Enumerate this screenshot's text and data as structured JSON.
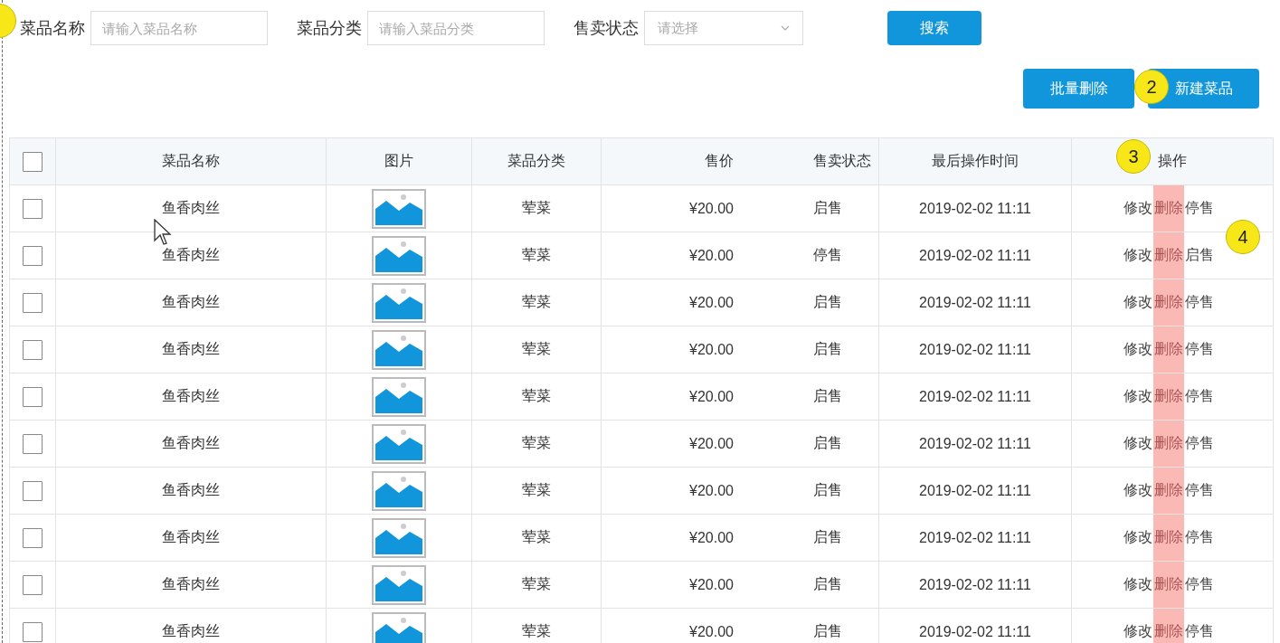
{
  "filters": [
    {
      "label": "菜品名称",
      "kind": "input",
      "placeholder": "请输入菜品名称"
    },
    {
      "label": "菜品分类",
      "kind": "input",
      "placeholder": "请输入菜品分类"
    },
    {
      "label": "售卖状态",
      "kind": "select",
      "placeholder": "请选择"
    }
  ],
  "search_button": "搜索",
  "action_buttons": [
    "批量删除",
    "新建菜品"
  ],
  "annotations": [
    {
      "label": "2"
    },
    {
      "label": "3"
    },
    {
      "label": "4"
    }
  ],
  "table": {
    "select_all": {
      "checked": false
    },
    "columns": [
      "菜品名称",
      "图片",
      "菜品分类",
      "售价",
      "售卖状态",
      "最后操作时间",
      "操作"
    ],
    "rows": [
      {
        "checked": false,
        "name": "鱼香肉丝",
        "category": "荤菜",
        "price": "¥20.00",
        "status": "启售",
        "time": "2019-02-02 11:11",
        "actions": [
          "修改",
          "删除",
          "停售"
        ]
      },
      {
        "checked": false,
        "name": "鱼香肉丝",
        "category": "荤菜",
        "price": "¥20.00",
        "status": "停售",
        "time": "2019-02-02 11:11",
        "actions": [
          "修改",
          "删除",
          "启售"
        ]
      },
      {
        "checked": false,
        "name": "鱼香肉丝",
        "category": "荤菜",
        "price": "¥20.00",
        "status": "启售",
        "time": "2019-02-02 11:11",
        "actions": [
          "修改",
          "删除",
          "停售"
        ]
      },
      {
        "checked": false,
        "name": "鱼香肉丝",
        "category": "荤菜",
        "price": "¥20.00",
        "status": "启售",
        "time": "2019-02-02 11:11",
        "actions": [
          "修改",
          "删除",
          "停售"
        ]
      },
      {
        "checked": false,
        "name": "鱼香肉丝",
        "category": "荤菜",
        "price": "¥20.00",
        "status": "启售",
        "time": "2019-02-02 11:11",
        "actions": [
          "修改",
          "删除",
          "停售"
        ]
      },
      {
        "checked": false,
        "name": "鱼香肉丝",
        "category": "荤菜",
        "price": "¥20.00",
        "status": "启售",
        "time": "2019-02-02 11:11",
        "actions": [
          "修改",
          "删除",
          "停售"
        ]
      },
      {
        "checked": false,
        "name": "鱼香肉丝",
        "category": "荤菜",
        "price": "¥20.00",
        "status": "启售",
        "time": "2019-02-02 11:11",
        "actions": [
          "修改",
          "删除",
          "停售"
        ]
      },
      {
        "checked": false,
        "name": "鱼香肉丝",
        "category": "荤菜",
        "price": "¥20.00",
        "status": "启售",
        "time": "2019-02-02 11:11",
        "actions": [
          "修改",
          "删除",
          "停售"
        ]
      },
      {
        "checked": false,
        "name": "鱼香肉丝",
        "category": "荤菜",
        "price": "¥20.00",
        "status": "启售",
        "time": "2019-02-02 11:11",
        "actions": [
          "修改",
          "删除",
          "停售"
        ]
      },
      {
        "checked": false,
        "name": "鱼香肉丝",
        "category": "荤菜",
        "price": "¥20.00",
        "status": "启售",
        "time": "2019-02-02 11:11",
        "actions": [
          "修改",
          "删除",
          "停售"
        ]
      }
    ]
  }
}
